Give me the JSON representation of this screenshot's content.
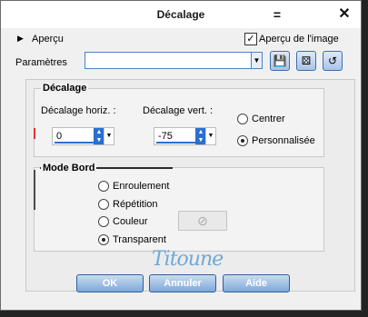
{
  "window": {
    "title": "Décalage"
  },
  "titlebar": {
    "menu_glyph": "=",
    "close_glyph": "✕"
  },
  "preview": {
    "expander_glyph": "▶",
    "label": "Aperçu",
    "checkbox_label": "Aperçu de l'image",
    "checked": true
  },
  "params": {
    "label": "Paramètres",
    "value": ""
  },
  "offset_group": {
    "title": "Décalage",
    "horiz_label": "Décalage horiz. :",
    "horiz_value": "0",
    "vert_label": "Décalage vert. :",
    "vert_value": "-75",
    "center_label": "Centrer",
    "custom_label": "Personnalisée",
    "selected": "custom"
  },
  "edge_group": {
    "title": "Mode Bord",
    "options": [
      "Enroulement",
      "Répétition",
      "Couleur",
      "Transparent"
    ],
    "selected": "Transparent"
  },
  "watermark": "Titoune",
  "buttons": {
    "ok": "OK",
    "cancel": "Annuler",
    "help": "Aide"
  }
}
